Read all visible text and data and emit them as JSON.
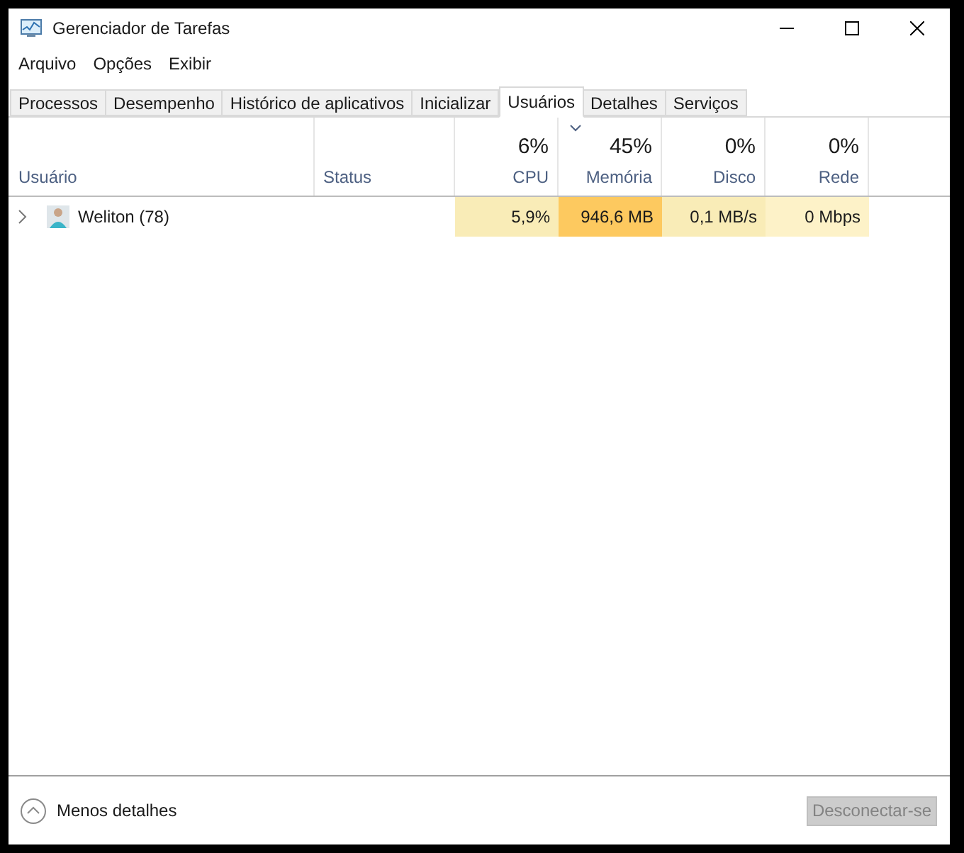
{
  "window": {
    "title": "Gerenciador de Tarefas"
  },
  "menu": [
    "Arquivo",
    "Opções",
    "Exibir"
  ],
  "tabs": [
    {
      "label": "Processos",
      "selected": false
    },
    {
      "label": "Desempenho",
      "selected": false
    },
    {
      "label": "Histórico de aplicativos",
      "selected": false
    },
    {
      "label": "Inicializar",
      "selected": false
    },
    {
      "label": "Usuários",
      "selected": true
    },
    {
      "label": "Detalhes",
      "selected": false
    },
    {
      "label": "Serviços",
      "selected": false
    }
  ],
  "table": {
    "name_column": "Usuário",
    "status_column": "Status",
    "columns": [
      {
        "percent": "6%",
        "label": "CPU",
        "sorted": false
      },
      {
        "percent": "45%",
        "label": "Memória",
        "sorted": true
      },
      {
        "percent": "0%",
        "label": "Disco",
        "sorted": false
      },
      {
        "percent": "0%",
        "label": "Rede",
        "sorted": false
      }
    ],
    "rows": [
      {
        "name": "Weliton (78)",
        "expanded": false,
        "cells": [
          {
            "value": "5,9%",
            "color": "#f9ecb7"
          },
          {
            "value": "946,6 MB",
            "color": "#fdc95f"
          },
          {
            "value": "0,1 MB/s",
            "color": "#f9ecb7"
          },
          {
            "value": "0 Mbps",
            "color": "#fdf2c8"
          }
        ]
      }
    ]
  },
  "footer": {
    "details_label": "Menos detalhes",
    "button": {
      "label": "Desconectar-se",
      "disabled": true
    }
  }
}
